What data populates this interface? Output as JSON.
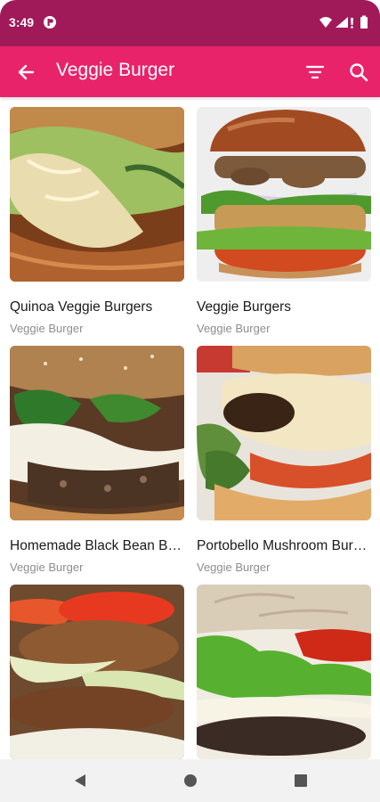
{
  "status_bar": {
    "time": "3:49",
    "icons": [
      "app-notification-icon",
      "wifi-icon",
      "signal-icon",
      "battery-icon"
    ]
  },
  "app_bar": {
    "title": "Veggie Burger",
    "icons": [
      "arrow-back-icon",
      "filter-icon",
      "search-icon"
    ],
    "background_color": "#e8236a"
  },
  "recipes": [
    {
      "name": "Quinoa Veggie Burgers",
      "category": "Veggie Burger"
    },
    {
      "name": "Veggie Burgers",
      "category": "Veggie Burger"
    },
    {
      "name": "Homemade Black Bean Burgers",
      "category": "Veggie Burger"
    },
    {
      "name": "Portobello Mushroom Burgers",
      "category": "Veggie Burger"
    },
    {
      "name": "",
      "category": ""
    },
    {
      "name": "",
      "category": ""
    }
  ],
  "nav_bar": {
    "icons": [
      "nav-back-icon",
      "nav-home-icon",
      "nav-recents-icon"
    ]
  }
}
